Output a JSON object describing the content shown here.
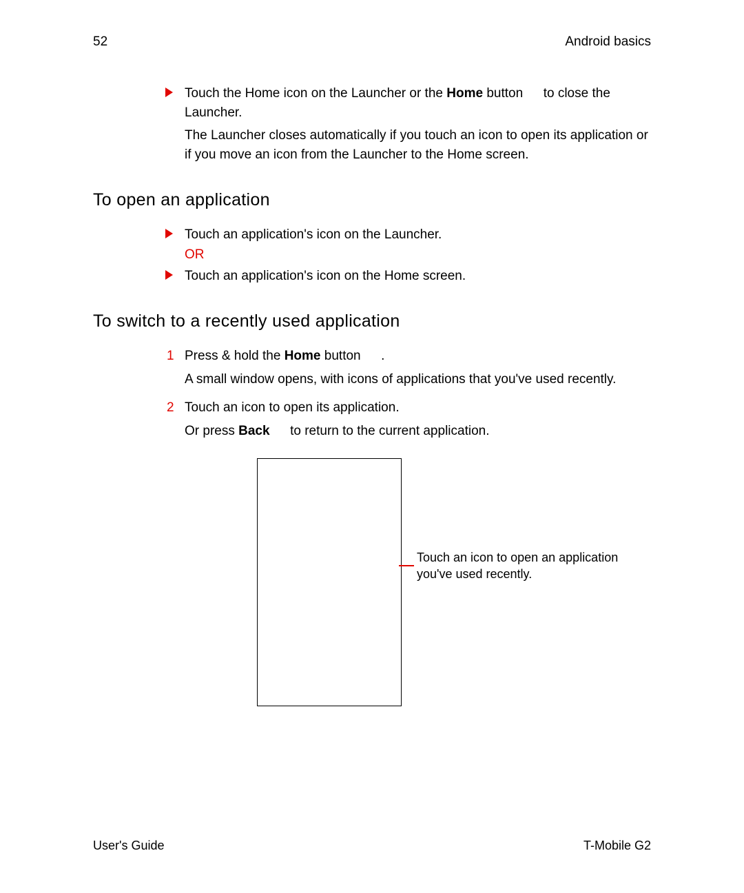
{
  "header": {
    "page_number": "52",
    "section": "Android basics"
  },
  "intro": {
    "bullet_pre": "Touch the Home icon on the Launcher or the ",
    "bullet_bold": "Home",
    "bullet_post": " button   to close the Launcher.",
    "para": "The Launcher closes automatically if you touch an icon to open its application or if you move an icon from the Launcher to the Home screen."
  },
  "h1": "To open an application",
  "sec1": {
    "b1": "Touch an application's icon on the Launcher.",
    "or": "OR",
    "b2": "Touch an application's icon on the Home screen."
  },
  "h2": "To switch to a recently used application",
  "sec2": {
    "step1_num": "1",
    "step1_pre": "Press & hold the ",
    "step1_bold": "Home",
    "step1_post": " button   .",
    "step1_para": "A small window opens, with icons of applications that you've used recently.",
    "step2_num": "2",
    "step2_text": "Touch an icon to open its application.",
    "step2_para_pre": "Or press ",
    "step2_para_bold": "Back",
    "step2_para_post": "   to return to the current application."
  },
  "callout": "Touch an icon to open an application you've used recently.",
  "footer": {
    "left": "User's Guide",
    "right": "T-Mobile G2"
  }
}
